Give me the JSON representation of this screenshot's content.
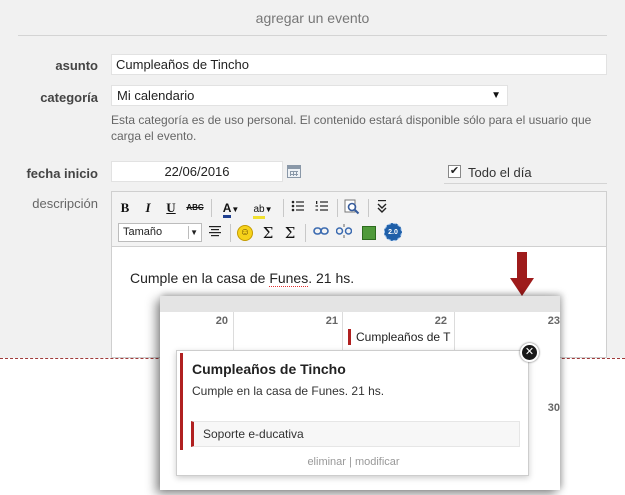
{
  "form": {
    "title": "agregar un evento",
    "subject_label": "asunto",
    "subject_value": "Cumpleaños de Tincho",
    "category_label": "categoría",
    "category_value": "Mi calendario",
    "category_help": "Esta categoría es de uso personal. El contenido estará disponible sólo para el usuario que carga el evento.",
    "start_label": "fecha inicio",
    "start_value": "22/06/2016",
    "allday_label": "Todo el día",
    "allday_checked": true,
    "description_label": "descripción"
  },
  "editor": {
    "toolbar": {
      "bold": "B",
      "italic": "I",
      "underline": "U",
      "strike": "ABC",
      "font_color": "A",
      "highlight": "ab",
      "size_select": "Tamaño"
    },
    "content_before": "Cumple en la casa de ",
    "content_word": "Funes",
    "content_after": ". 21 hs."
  },
  "calendar": {
    "days": [
      "20",
      "21",
      "22",
      "23",
      "30"
    ],
    "event_label": "Cumpleaños de T"
  },
  "popup": {
    "title": "Cumpleaños de Tincho",
    "description": "Cumple en la casa de Funes. 21 hs.",
    "calendar_name": "Soporte e-ducativa",
    "delete_label": "eliminar",
    "separator": "|",
    "edit_label": "modificar"
  },
  "colors": {
    "accent": "#b02020",
    "arrow": "#9e1b1b",
    "form_bg": "#f1f1f1"
  }
}
